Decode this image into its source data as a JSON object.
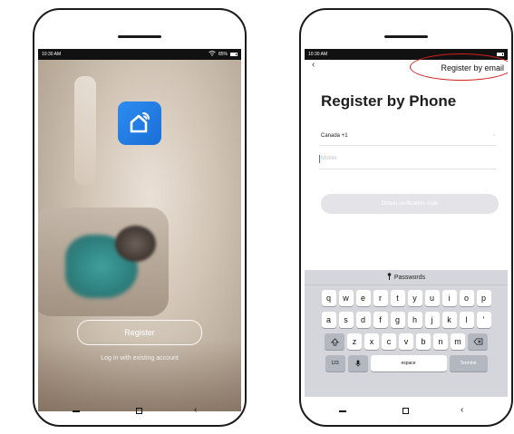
{
  "status": {
    "time": "10:30 AM",
    "battery": "85%"
  },
  "screen1": {
    "register_label": "Register",
    "login_label": "Log in with existing account"
  },
  "screen2": {
    "back_symbol": "‹",
    "email_link": "Register by email",
    "title": "Register by Phone",
    "country": "Canada +1",
    "country_arrow": "›",
    "mobile_placeholder": "Mobile",
    "verify_label": "Obtain verification code",
    "keyboard": {
      "suggestion": "Passwords",
      "row1": [
        "q",
        "w",
        "e",
        "r",
        "t",
        "y",
        "u",
        "i",
        "o",
        "p"
      ],
      "row2": [
        "a",
        "s",
        "d",
        "f",
        "g",
        "h",
        "j",
        "k",
        "l",
        "'"
      ],
      "row3": [
        "z",
        "x",
        "c",
        "v",
        "b",
        "n",
        "m"
      ],
      "numbers_label": "123",
      "space_label": "espace",
      "return_label": "Terminé"
    }
  },
  "navbar": {
    "back_symbol": "‹"
  },
  "icons": [
    "home-wifi-icon",
    "wifi-icon",
    "battery-icon",
    "key-icon",
    "shift-icon",
    "backspace-icon",
    "microphone-icon"
  ],
  "colors": {
    "app_icon": "#2d8cf0",
    "highlight_ellipse": "#d11f1f",
    "keyboard_bg": "#d4d6dc"
  }
}
